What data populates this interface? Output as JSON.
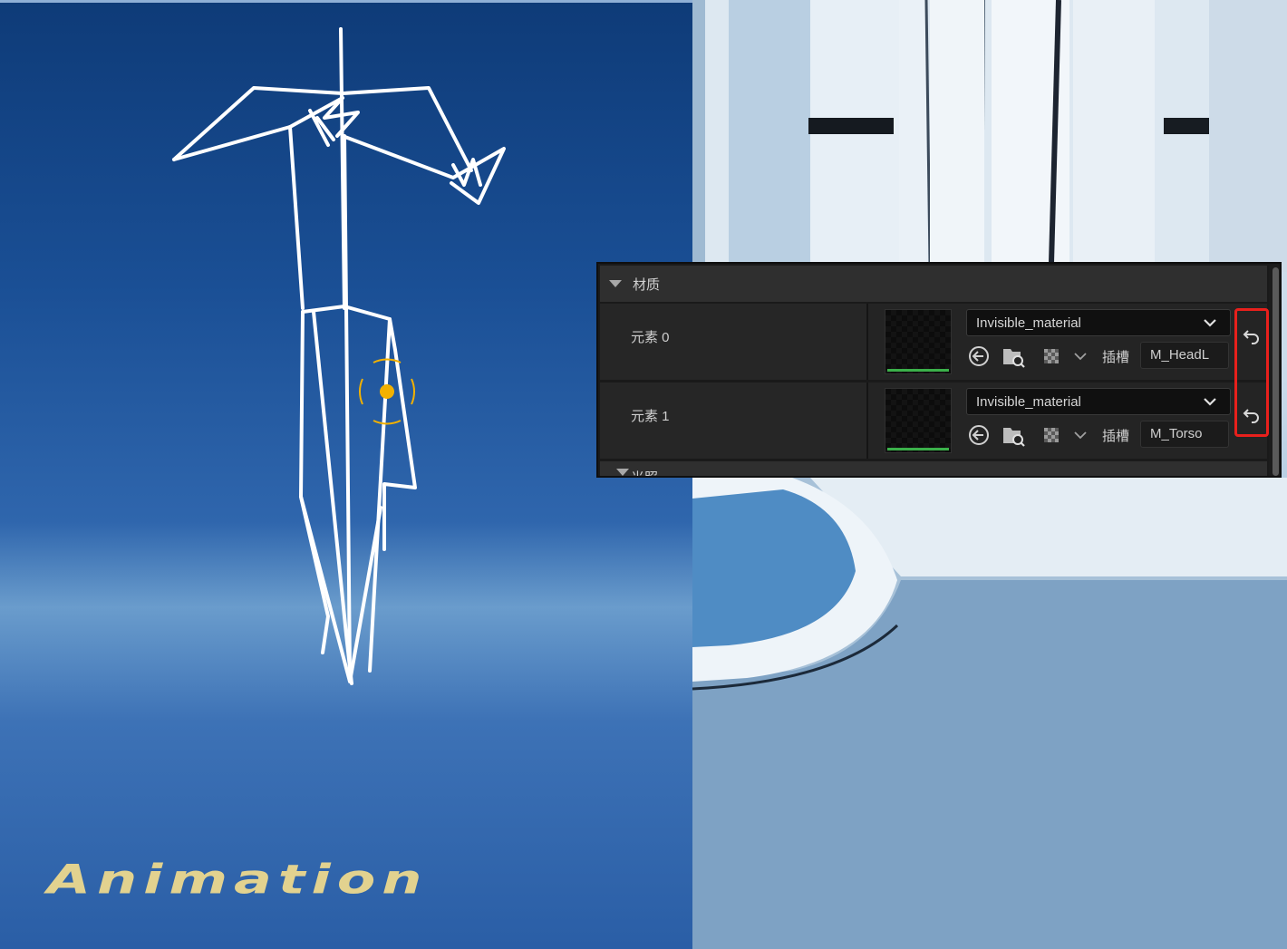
{
  "viewport_left": {
    "overlay_text": "Animation"
  },
  "details_panel": {
    "category": "材质",
    "elements": [
      {
        "label": "元素 0",
        "material": "Invisible_material",
        "slot_label": "插槽",
        "slot_value": "M_HeadL"
      },
      {
        "label": "元素 1",
        "material": "Invisible_material",
        "slot_label": "插槽",
        "slot_value": "M_Torso"
      }
    ],
    "next_category": "光照"
  },
  "icons": {
    "category_toggle": "triangle-down-icon",
    "dropdown": "chevron-down-icon",
    "use_selected": "arrow-left-circle-icon",
    "browse": "folder-search-icon",
    "checker": "checker-icon",
    "reset": "reset-arrow-icon"
  },
  "colors": {
    "highlight": "#e8201c",
    "thumbnail_underline": "#3bb04a",
    "viewport_left_bg": "#1a4f95",
    "skeleton_stroke": "#ffffff",
    "pivot": "#f2b100",
    "overlay_text": "#e2d28f"
  }
}
